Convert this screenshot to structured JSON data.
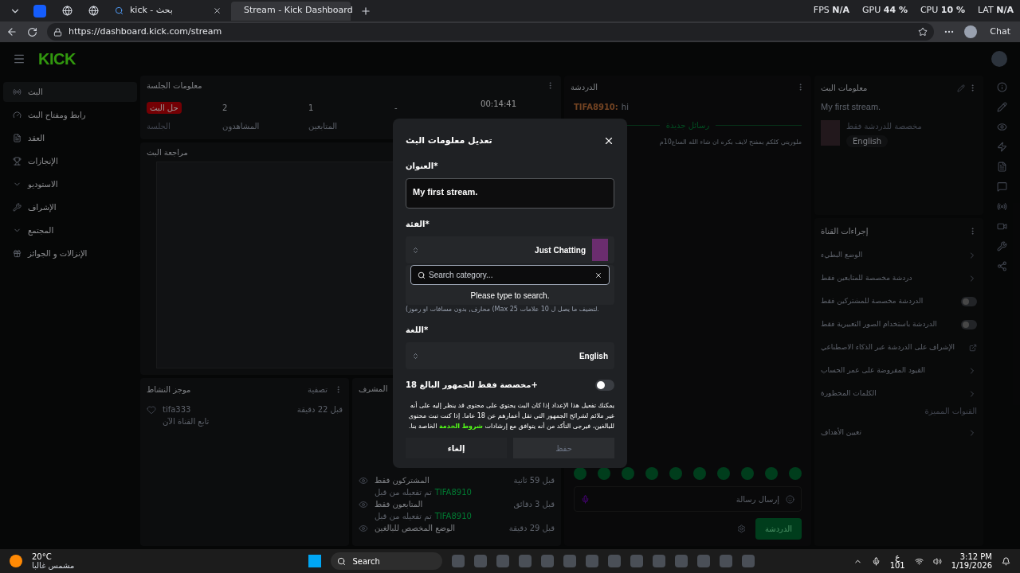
{
  "browser": {
    "tabs": [
      {
        "title": "Stream - Kick Dashboard",
        "selected": true
      },
      {
        "title": "kick - بحث",
        "selected": false
      }
    ],
    "stats": [
      "LAT **N/A**",
      "CPU **10 %**",
      "GPU **44 %**",
      "FPS **N/A**"
    ],
    "url": "https://dashboard.kick.com/stream",
    "chat_button": "Chat"
  },
  "logo": "KICK",
  "sidebar": {
    "items": [
      {
        "label": "البث",
        "selected": true,
        "expandable": false
      },
      {
        "label": "رابط ومفتاح البث",
        "selected": false,
        "expandable": false
      },
      {
        "label": "العقد",
        "selected": false,
        "expandable": false
      },
      {
        "label": "الإنجازات",
        "selected": false,
        "expandable": false
      },
      {
        "label": "الاستوديو",
        "selected": false,
        "expandable": true
      },
      {
        "label": "الإشراف",
        "selected": false,
        "expandable": false
      },
      {
        "label": "المجتمع",
        "selected": false,
        "expandable": true
      },
      {
        "label": "الإنزالات و الجوائز",
        "selected": false,
        "expandable": false
      }
    ]
  },
  "session": {
    "title": "معلومات الجلسة",
    "badge": "حل البث",
    "badge_label": "الجلسة",
    "stats": [
      {
        "value": "-"
      },
      {
        "value": "1",
        "label": "المتابعين"
      },
      {
        "value": "2",
        "label": "المشاهدون"
      }
    ],
    "time": "00:14:41"
  },
  "preview": {
    "title": "مراجعة البث"
  },
  "activity": {
    "title": "موجز النشاط",
    "filter": "تصفية",
    "items": [
      {
        "name": "tifa333",
        "action": "تابع القناة الآن",
        "time": "قبل 22 دقيقة"
      }
    ]
  },
  "mod_log": {
    "title": "المشرف",
    "items": [
      {
        "title": "المشتركون فقط",
        "by": "تم تفعيله من قبل",
        "user": "TIFA8910",
        "time": "قبل 59 ثانية"
      },
      {
        "title": "المتابعون فقط",
        "by": "تم تفعيله من قبل",
        "user": "TIFA8910",
        "time": "قبل 3 دقائق"
      },
      {
        "title": "الوضع المخصص للبالغين",
        "time": "قبل 29 دقيقة"
      }
    ]
  },
  "chat": {
    "title": "الدردشة",
    "messages": [
      {
        "user": "TIFA8910:",
        "text": "hi"
      }
    ],
    "divider": "رسائل جديدة",
    "system_message": "ملوريتي كلكم بمفتح لايف بكره ان شاء الله الساع10م",
    "input_placeholder": "إرسال رسالة",
    "send_button": "الدردشة"
  },
  "stream_info": {
    "title": "معلومات البث",
    "stream_title": "My first stream.",
    "category": "مخصصة للدردشة فقط",
    "language": "English"
  },
  "channel_actions": {
    "title": "إجراءات القناة",
    "items": [
      {
        "label": "الوضع البطيء",
        "kind": "link"
      },
      {
        "label": "دردشة مخصصة للمتابعين فقط",
        "kind": "link"
      },
      {
        "label": "الدردشة مخصصة للمشتركين فقط",
        "kind": "toggle",
        "on": false
      },
      {
        "label": "الدردشة باستخدام الصور التعبيرية فقط",
        "kind": "toggle",
        "on": false
      },
      {
        "label": "الإشراف على الدردشة عبر الذكاء الاصطناعي",
        "kind": "external"
      },
      {
        "label": "القيود المفروضة على عمر الحساب",
        "kind": "link"
      },
      {
        "label": "الكلمات المحظورة",
        "kind": "link"
      },
      {
        "label": "القنوات المميزة",
        "kind": "section"
      },
      {
        "label": "تعيين الأهداف",
        "kind": "link"
      }
    ]
  },
  "modal": {
    "title": "تعديل معلومات البث",
    "title_label": "العنوان*",
    "title_value": "My first stream.",
    "category_label": "الفئة*",
    "category_value": "Just Chatting",
    "search_placeholder": "Search category...",
    "search_hint": "Please type to search.",
    "tags_hint": "(محارف, بدون مسافات او رموز (Max 25 لتضيف ما يصل ل 10 علامات.",
    "language_label": "اللغة*",
    "language_value": "English",
    "adult_label": "مخصصة فقط للجمهور البالغ 18+",
    "adult_on": false,
    "adult_text": "يمكنك تفعيل هذا الإعداد إذا كان البث يحتوي على محتوى قد ينظر إليه على أنه غير ملائم لشرائح الجمهور التي تقل أعمارهم عن 18 عاما. إذا كنت تبث محتوى للبالغين، فيرجى التأكد من أنه يتوافق مع إرشادات **شروط الخدمة** الخاصة بنا.",
    "cancel": "إلغاء",
    "save": "حفظ",
    "save_disabled": true
  },
  "taskbar": {
    "temperature": "20°C",
    "weather": "مشمس غالبا",
    "search": "Search",
    "lang": "ع",
    "lang_sub": "101",
    "time": "3:12 PM",
    "date": "1/19/2026"
  }
}
